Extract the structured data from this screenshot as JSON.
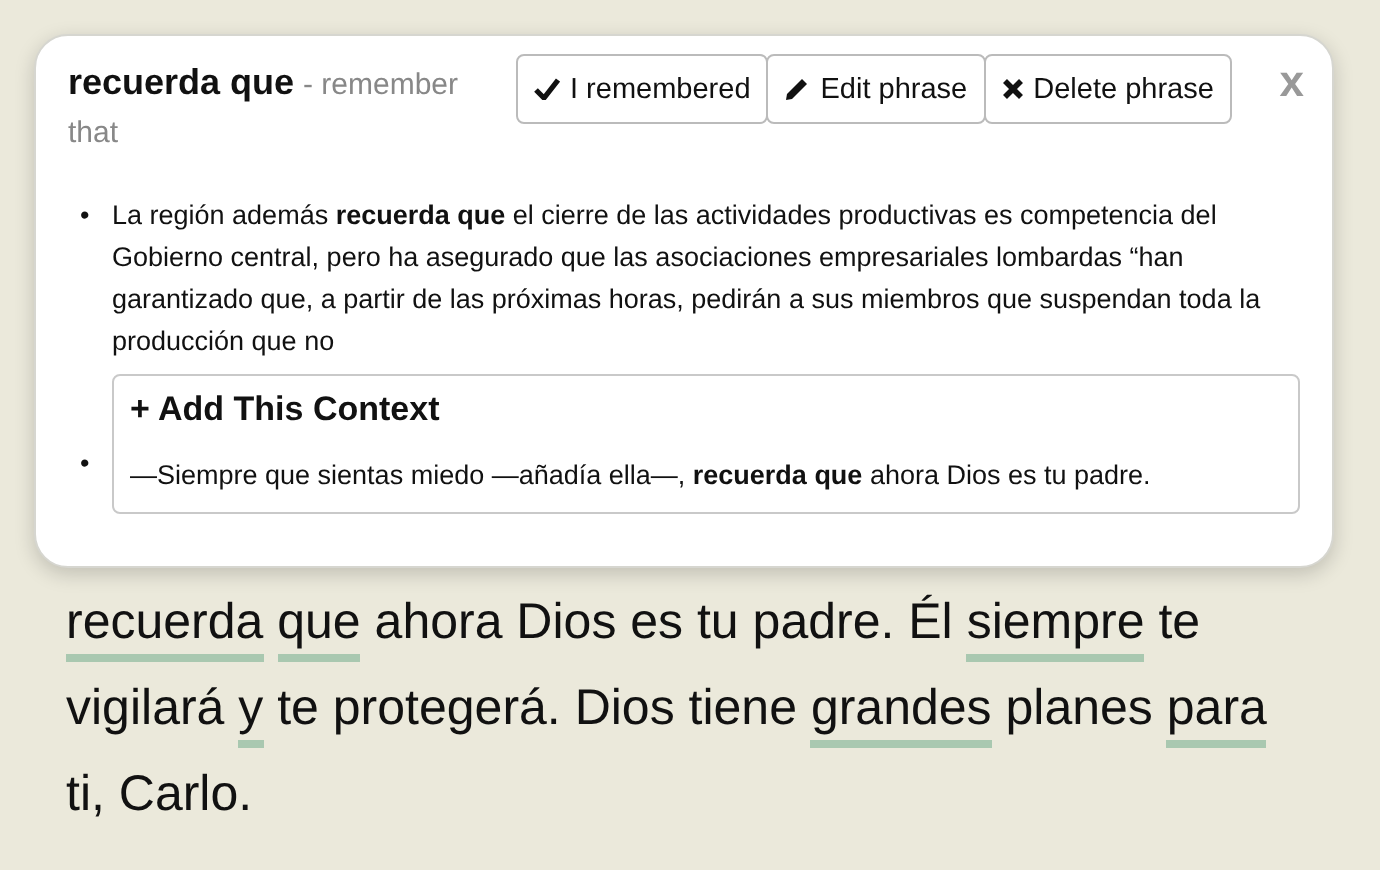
{
  "popup": {
    "phrase": "recuerda que",
    "translation": "- remember that",
    "buttons": [
      {
        "kind": "check",
        "label": "I remembered"
      },
      {
        "kind": "edit",
        "label": "Edit phrase"
      },
      {
        "kind": "delete",
        "label": "Delete phrase"
      }
    ],
    "close": "x",
    "examples": [
      {
        "marker": "•",
        "text": "La región además **recuerda que** el cierre de las actividades productivas es competencia del Gobierno central, pero ha asegurado que las asociaciones empresariales lombardas “han garantizado que, a partir de las próximas horas, pedirán a sus miembros que suspendan toda la producción que no",
        "context_box": false
      },
      {
        "marker": "•",
        "text": "—Siempre que sientas miedo —añadía ella—, **recuerda que** ahora Dios es tu padre.",
        "context_box": true,
        "action": "+ Add This Context"
      }
    ]
  },
  "reading": {
    "lines": [
      [
        {
          "text": "recuerda",
          "underlined": true
        },
        {
          "text": "que",
          "underlined": true
        },
        {
          "text": "ahora Dios es tu padre. Él",
          "underlined": false
        },
        {
          "text": "siempre",
          "underlined": true
        },
        {
          "text": "te",
          "underlined": false
        }
      ],
      [
        {
          "text": "vigilará",
          "underlined": false
        },
        {
          "text": "y",
          "underlined": true
        },
        {
          "text": "te protegerá. Dios tiene",
          "underlined": false
        },
        {
          "text": "grandes",
          "underlined": true
        },
        {
          "text": "planes",
          "underlined": false
        },
        {
          "text": "para",
          "underlined": true
        }
      ],
      [
        {
          "text": "ti, Carlo.",
          "underlined": false
        }
      ]
    ]
  }
}
